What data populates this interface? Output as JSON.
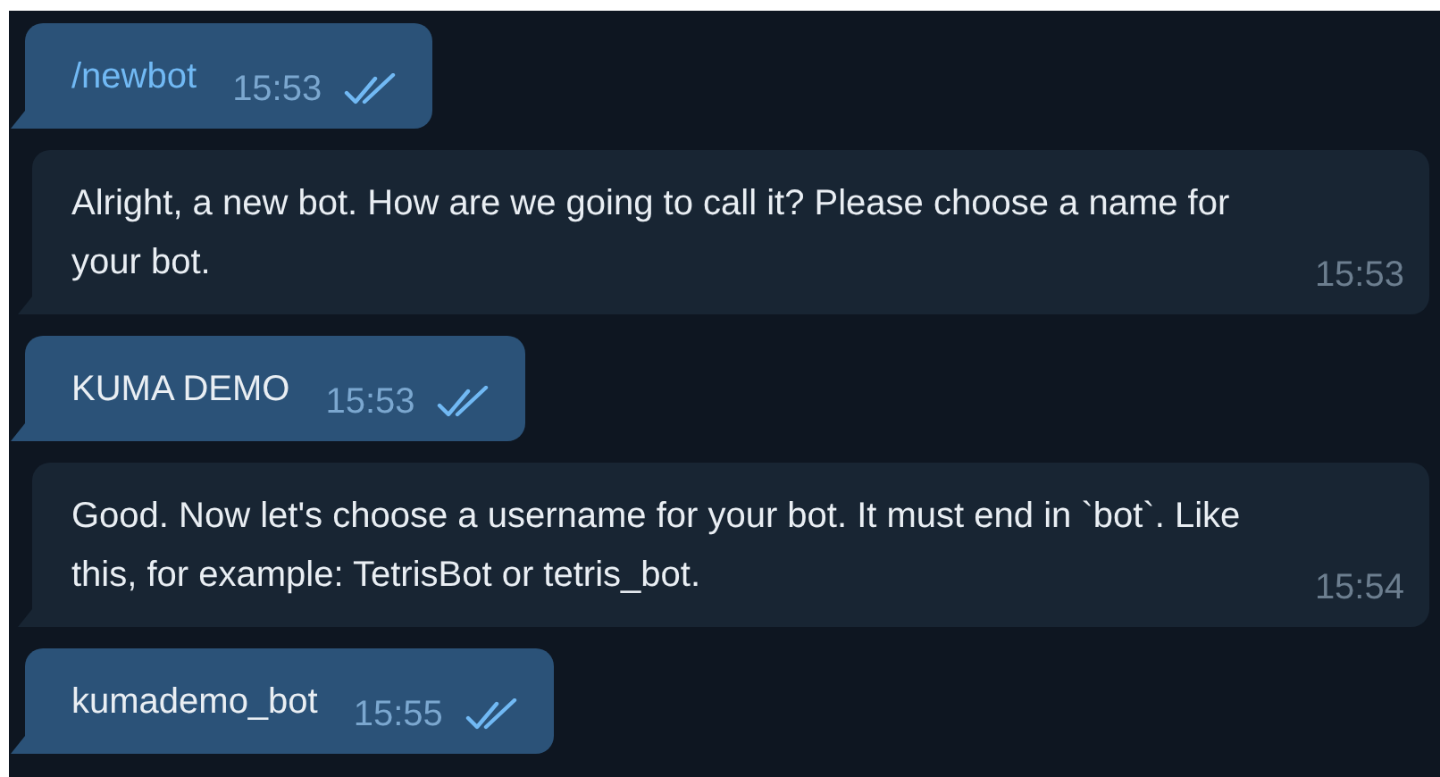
{
  "messages": [
    {
      "kind": "outgoing",
      "text": "/newbot",
      "command": true,
      "time": "15:53",
      "read": true
    },
    {
      "kind": "incoming",
      "text": "Alright, a new bot. How are we going to call it? Please choose a name for your bot.",
      "time": "15:53"
    },
    {
      "kind": "outgoing",
      "text": "KUMA DEMO",
      "command": false,
      "time": "15:53",
      "read": true
    },
    {
      "kind": "incoming",
      "text": "Good. Now let's choose a username for your bot. It must end in `bot`. Like this, for example: TetrisBot or tetris_bot.",
      "time": "15:54"
    },
    {
      "kind": "outgoing",
      "text": "kumademo_bot",
      "command": false,
      "time": "15:55",
      "read": true
    }
  ]
}
